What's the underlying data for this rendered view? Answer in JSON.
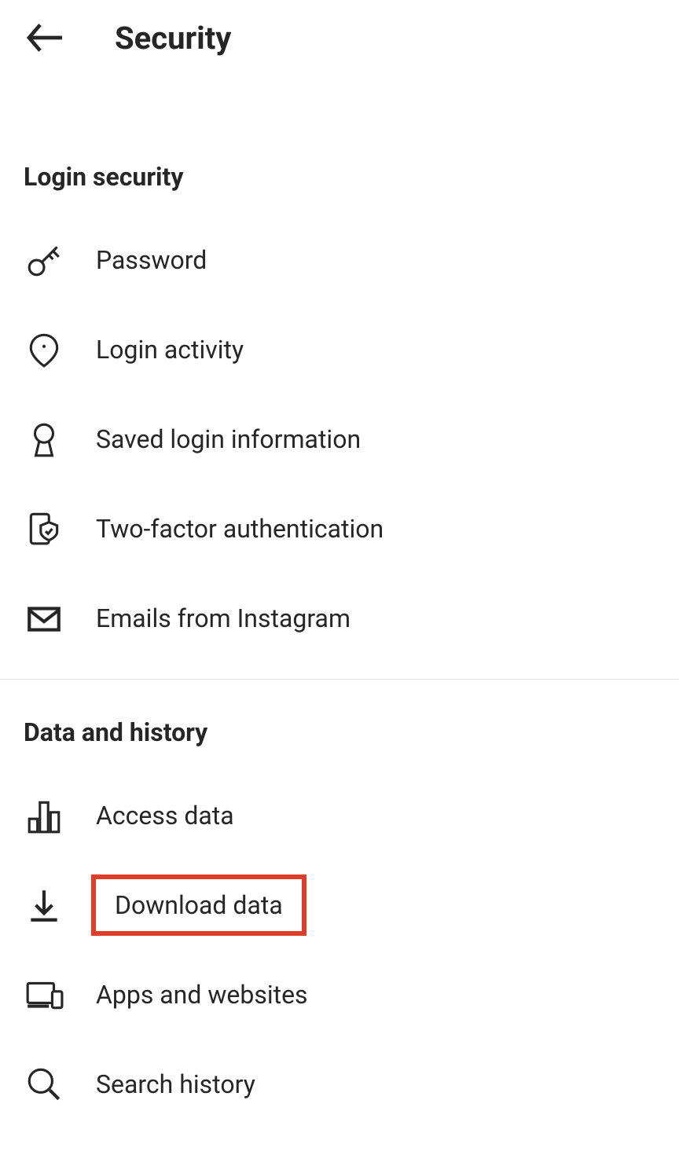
{
  "header": {
    "title": "Security"
  },
  "sections": {
    "login_security": {
      "title": "Login security",
      "items": [
        {
          "label": "Password"
        },
        {
          "label": "Login activity"
        },
        {
          "label": "Saved login information"
        },
        {
          "label": "Two-factor authentication"
        },
        {
          "label": "Emails from Instagram"
        }
      ]
    },
    "data_history": {
      "title": "Data and history",
      "items": [
        {
          "label": "Access data"
        },
        {
          "label": "Download data",
          "highlighted": true
        },
        {
          "label": "Apps and websites"
        },
        {
          "label": "Search history"
        }
      ]
    }
  },
  "highlight_color": "#e03c2a"
}
